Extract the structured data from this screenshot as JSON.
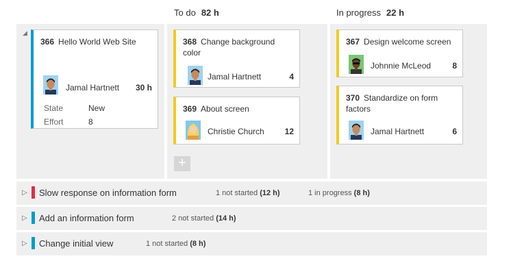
{
  "columns": [
    {
      "label": "To do",
      "hours": "82 h"
    },
    {
      "label": "In progress",
      "hours": "22 h"
    }
  ],
  "story": {
    "id": "366",
    "title": "Hello World Web Site",
    "assignee": "Jamal Hartnett",
    "remaining": "30 h",
    "fields": [
      {
        "label": "State",
        "value": "New"
      },
      {
        "label": "Effort",
        "value": "8"
      }
    ]
  },
  "todo_tasks": [
    {
      "id": "368",
      "title": "Change background color",
      "assignee": "Jamal Hartnett",
      "remaining": "4"
    },
    {
      "id": "369",
      "title": "About screen",
      "assignee": "Christie Church",
      "remaining": "12"
    }
  ],
  "inprogress_tasks": [
    {
      "id": "367",
      "title": "Design welcome screen",
      "assignee": "Johnnie McLeod",
      "remaining": "8"
    },
    {
      "id": "370",
      "title": "Standardize on form factors",
      "assignee": "Jamal Hartnett",
      "remaining": "6"
    }
  ],
  "add_task_label": "+",
  "collapsed_rows": [
    {
      "title": "Slow response on information form",
      "color": "#e12d42",
      "stat1_prefix": "1 not started ",
      "stat1_hours": "(12 h)",
      "stat2_prefix": "1 in progress ",
      "stat2_hours": "(8 h)"
    },
    {
      "title": "Add an information form",
      "color": "#009ccc",
      "stat1_prefix": "2 not started ",
      "stat1_hours": "(14 h)"
    },
    {
      "title": "Change initial view",
      "color": "#009ccc",
      "stat1_prefix": "1 not started ",
      "stat1_hours": "(8 h)"
    }
  ],
  "icons": {
    "collapse": "collapse-triangle-icon",
    "expand": "expand-triangle-icon",
    "add": "add-icon"
  },
  "colors": {
    "story_bar": "#009ccc",
    "task_bar": "#f2cb1d",
    "bug_bar": "#e12d42"
  }
}
